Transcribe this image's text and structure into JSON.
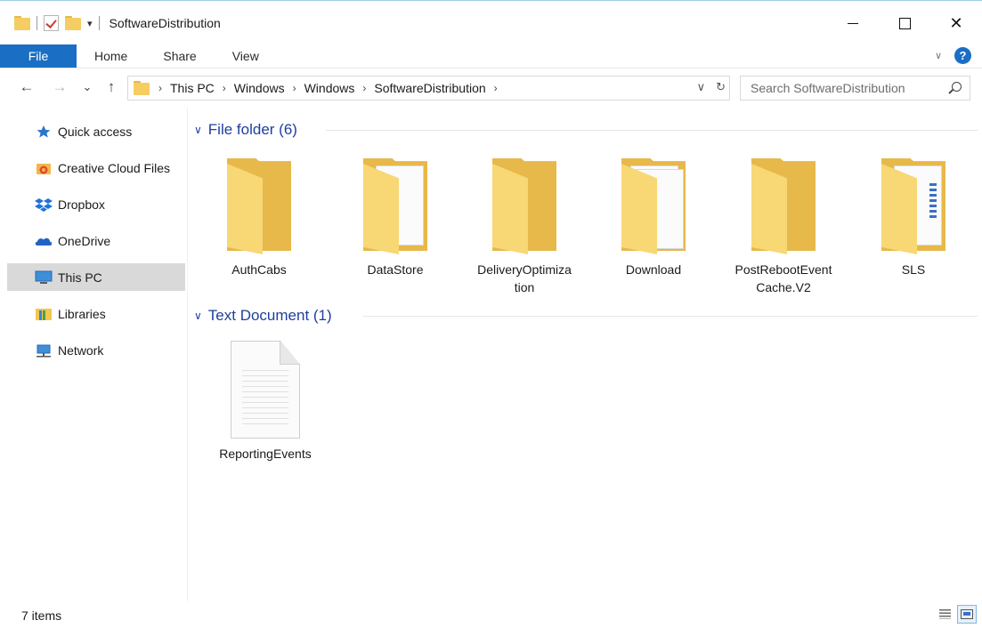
{
  "window": {
    "title": "SoftwareDistribution"
  },
  "ribbon": {
    "tabs": [
      {
        "label": "File"
      },
      {
        "label": "Home"
      },
      {
        "label": "Share"
      },
      {
        "label": "View"
      }
    ],
    "help_glyph": "?"
  },
  "nav": {
    "back_glyph": "←",
    "forward_glyph": "→",
    "recent_glyph": "⌄",
    "up_glyph": "↑"
  },
  "address": {
    "crumbs": [
      "This PC",
      "Windows",
      "Windows",
      "SoftwareDistribution"
    ],
    "separator": "›",
    "dropdown_glyph": "∨",
    "refresh_glyph": "↻"
  },
  "search": {
    "placeholder": "Search SoftwareDistribution"
  },
  "sidebar": {
    "items": [
      {
        "label": "Quick access",
        "icon": "star-icon",
        "selected": false
      },
      {
        "label": "Creative Cloud Files",
        "icon": "creative-cloud-icon",
        "selected": false
      },
      {
        "label": "Dropbox",
        "icon": "dropbox-icon",
        "selected": false
      },
      {
        "label": "OneDrive",
        "icon": "onedrive-icon",
        "selected": false
      },
      {
        "label": "This PC",
        "icon": "computer-icon",
        "selected": true
      },
      {
        "label": "Libraries",
        "icon": "libraries-icon",
        "selected": false
      },
      {
        "label": "Network",
        "icon": "network-icon",
        "selected": false
      }
    ]
  },
  "groups": [
    {
      "header": "File folder (6)",
      "items": [
        {
          "name_line1": "AuthCabs",
          "name_line2": "",
          "icon": "folder-icon"
        },
        {
          "name_line1": "DataStore",
          "name_line2": "",
          "icon": "folder-with-document-icon"
        },
        {
          "name_line1": "DeliveryOptimiza",
          "name_line2": "tion",
          "icon": "folder-icon"
        },
        {
          "name_line1": "Download",
          "name_line2": "",
          "icon": "folder-with-documents-icon"
        },
        {
          "name_line1": "PostRebootEvent",
          "name_line2": "Cache.V2",
          "icon": "folder-icon"
        },
        {
          "name_line1": "SLS",
          "name_line2": "",
          "icon": "folder-with-document-icon"
        }
      ]
    },
    {
      "header": "Text Document (1)",
      "items": [
        {
          "name_line1": "ReportingEvents",
          "name_line2": "",
          "icon": "text-document-icon"
        }
      ]
    }
  ],
  "status": {
    "item_count": "7 items"
  },
  "colors": {
    "accent": "#1a6fc4",
    "group_header": "#1e3f9e",
    "folder_back": "#e7b84a",
    "folder_front": "#f8d775",
    "selection": "#d9d9d9"
  }
}
